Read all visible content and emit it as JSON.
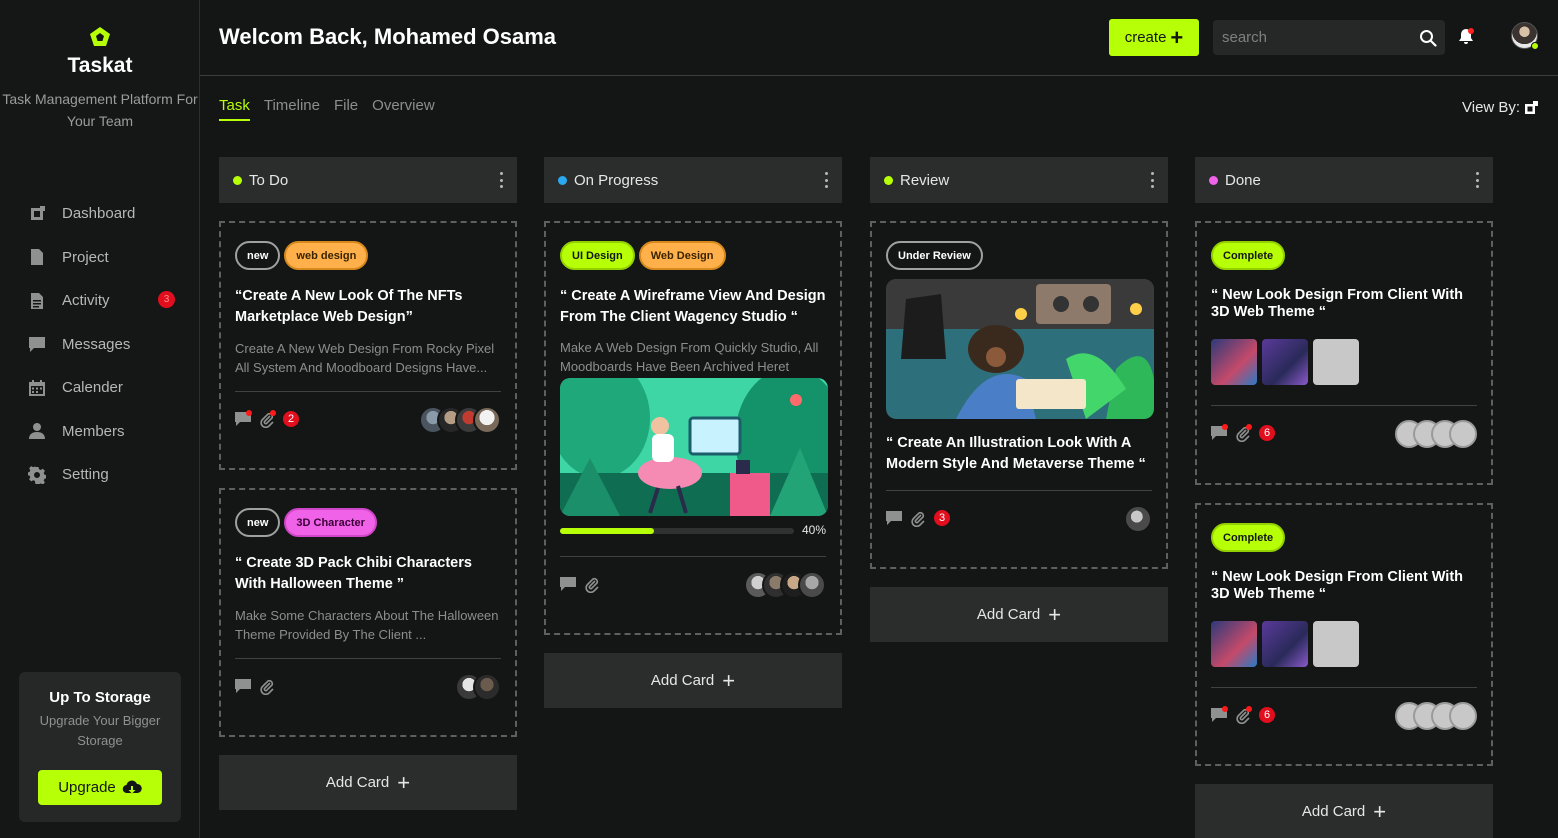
{
  "brand": {
    "name": "Taskat",
    "tagline": "Task Management Platform For Your Team"
  },
  "nav": [
    {
      "label": "Dashboard",
      "icon": "dashboard-icon"
    },
    {
      "label": "Project",
      "icon": "document-icon"
    },
    {
      "label": "Activity",
      "icon": "activity-icon",
      "badge": "3"
    },
    {
      "label": "Messages",
      "icon": "message-icon"
    },
    {
      "label": "Calender",
      "icon": "calendar-icon"
    },
    {
      "label": "Members",
      "icon": "user-icon"
    },
    {
      "label": "Setting",
      "icon": "gear-icon"
    }
  ],
  "storage": {
    "title": "Up To Storage",
    "subtitle": "Upgrade Your Bigger Storage",
    "button": "Upgrade"
  },
  "header": {
    "welcome": "Welcom Back, Mohamed Osama",
    "create_label": "create",
    "search_placeholder": "search"
  },
  "tabs": [
    "Task",
    "Timeline",
    "File",
    "Overview"
  ],
  "active_tab": "Task",
  "view_by": "View By:",
  "colors": {
    "accent": "#b7ff07",
    "todo": "#b7ff07",
    "progress": "#2aa8f0",
    "review": "#b7ff07",
    "done": "#f062e8",
    "badge": "#e10e1e"
  },
  "columns": [
    {
      "title": "To Do",
      "add_label": "Add Card",
      "cards": [
        {
          "tags": [
            "new",
            "web design"
          ],
          "title": "“Create A New Look Of The NFTs Marketplace Web Design”",
          "desc": "Create A New Web Design From Rocky Pixel All System And Moodboard Designs Have...",
          "count": "2"
        },
        {
          "tags": [
            "new",
            "3D Character"
          ],
          "title": "“ Create 3D Pack Chibi Characters With Halloween Theme ”",
          "desc": "Make Some Characters About The Halloween Theme Provided By The Client ..."
        }
      ]
    },
    {
      "title": "On Progress",
      "add_label": "Add Card",
      "cards": [
        {
          "tags": [
            "UI Design",
            "Web Design"
          ],
          "title": "“ Create A Wireframe View And Design From The Client Wagency Studio “",
          "desc": "Make A Web Design From Quickly Studio, All Moodboards Have Been Archived Heret",
          "progress": 40,
          "progress_label": "40%"
        }
      ]
    },
    {
      "title": "Review",
      "add_label": "Add Card",
      "cards": [
        {
          "tags": [
            "Under Review"
          ],
          "title": "“ Create An Illustration Look With A Modern Style And Metaverse Theme “",
          "count": "3"
        }
      ]
    },
    {
      "title": "Done",
      "add_label": "Add Card",
      "cards": [
        {
          "tags": [
            "Complete"
          ],
          "title": "“ New Look Design From Client With 3D Web Theme “",
          "count": "6"
        },
        {
          "tags": [
            "Complete"
          ],
          "title": "“ New Look Design From Client With 3D Web Theme “",
          "count": "6"
        }
      ]
    }
  ]
}
